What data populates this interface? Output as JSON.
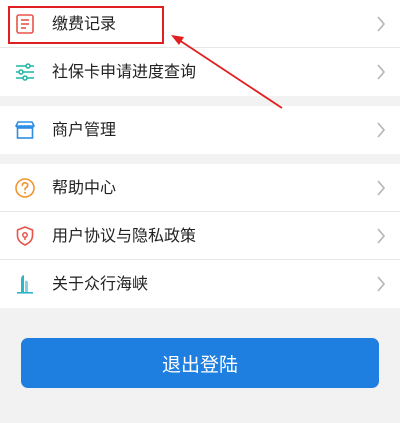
{
  "colors": {
    "accent": "#1f7fe0",
    "annotation": "#e02020",
    "background": "#f2f2f2",
    "text": "#222222"
  },
  "sections": [
    {
      "items": [
        {
          "label": "缴费记录",
          "icon": "receipt-icon",
          "icon_color": "#e8534a"
        },
        {
          "label": "社保卡申请进度查询",
          "icon": "progress-bars-icon",
          "icon_color": "#1fb5a8"
        }
      ]
    },
    {
      "items": [
        {
          "label": "商户管理",
          "icon": "storefront-icon",
          "icon_color": "#2f8de4"
        }
      ]
    },
    {
      "items": [
        {
          "label": "帮助中心",
          "icon": "help-question-icon",
          "icon_color": "#f0952e"
        },
        {
          "label": "用户协议与隐私政策",
          "icon": "shield-icon",
          "icon_color": "#e8534a"
        },
        {
          "label": "关于众行海峡",
          "icon": "building-icon",
          "icon_color": "#2fb4c8"
        }
      ]
    }
  ],
  "logout": {
    "label": "退出登陆"
  }
}
